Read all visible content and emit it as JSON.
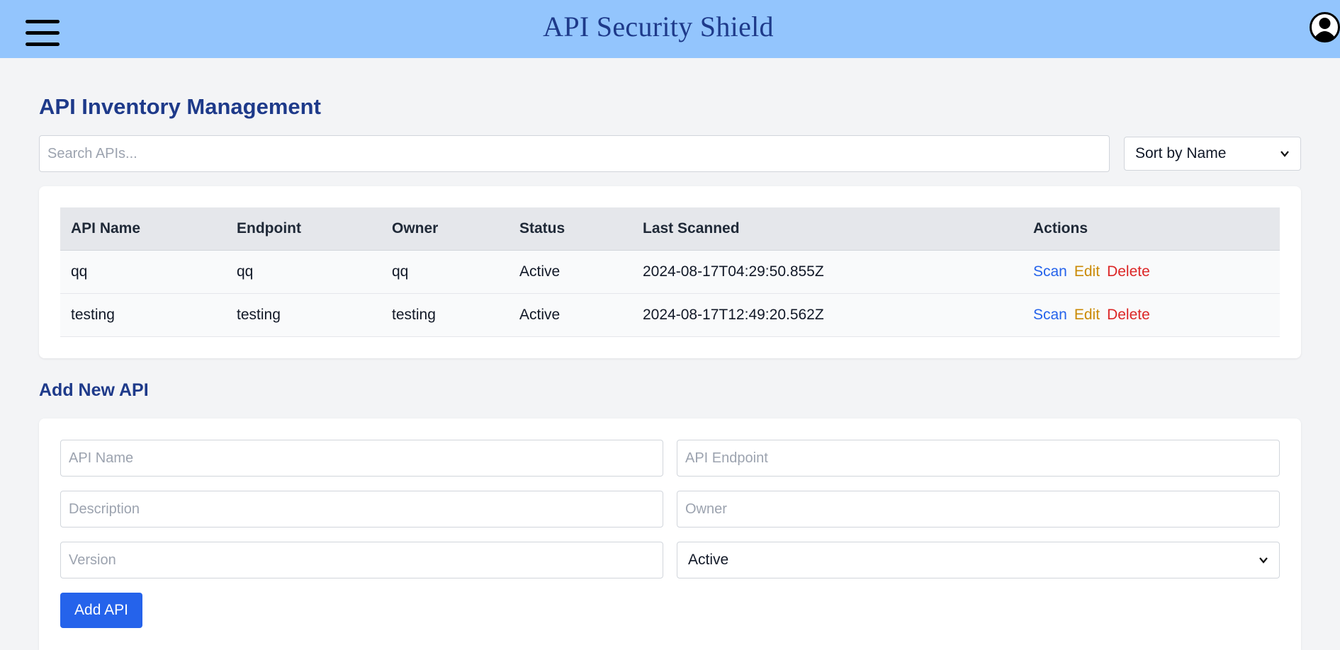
{
  "header": {
    "app_title": "API Security Shield",
    "menu_icon": "hamburger-menu-icon",
    "avatar_icon": "user-avatar-icon"
  },
  "inventory": {
    "heading": "API Inventory Management",
    "search_placeholder": "Search APIs...",
    "sort_selected": "Sort by Name",
    "columns": [
      "API Name",
      "Endpoint",
      "Owner",
      "Status",
      "Last Scanned",
      "Actions"
    ],
    "rows": [
      {
        "name": "qq",
        "endpoint": "qq",
        "owner": "qq",
        "status": "Active",
        "last_scanned": "2024-08-17T04:29:50.855Z"
      },
      {
        "name": "testing",
        "endpoint": "testing",
        "owner": "testing",
        "status": "Active",
        "last_scanned": "2024-08-17T12:49:20.562Z"
      }
    ],
    "actions": {
      "scan": "Scan",
      "edit": "Edit",
      "delete": "Delete"
    }
  },
  "add_form": {
    "heading": "Add New API",
    "name_placeholder": "API Name",
    "endpoint_placeholder": "API Endpoint",
    "description_placeholder": "Description",
    "owner_placeholder": "Owner",
    "version_placeholder": "Version",
    "status_selected": "Active",
    "submit_label": "Add API"
  },
  "colors": {
    "header_bg": "#93c5fd",
    "title": "#1e3a8a",
    "primary": "#2563eb",
    "scan": "#2563eb",
    "edit": "#ca8a04",
    "delete": "#dc2626"
  }
}
